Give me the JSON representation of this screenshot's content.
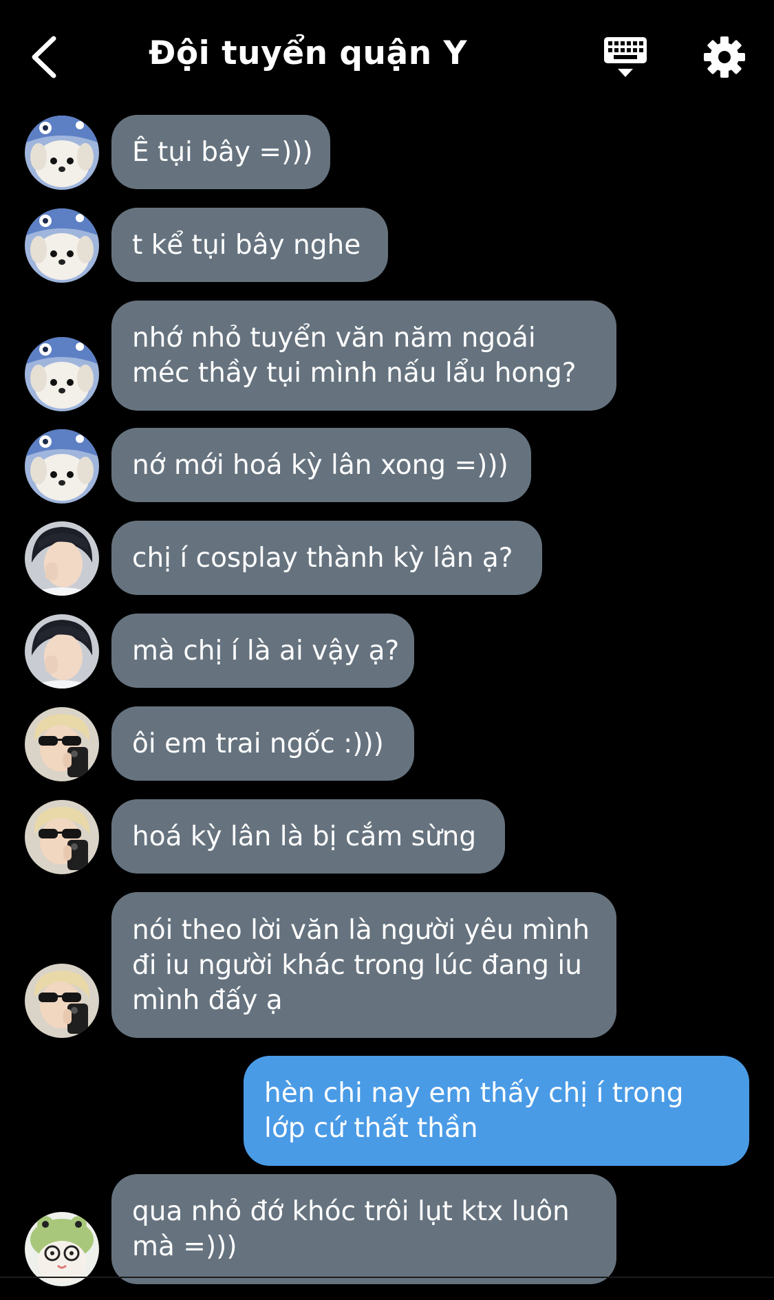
{
  "header": {
    "title": "Đội tuyển quận Y",
    "back_icon": "chevron-left-icon",
    "keyboard_icon": "keyboard-icon",
    "settings_icon": "gear-icon"
  },
  "colors": {
    "background": "#000000",
    "incoming_bubble": "#66737f",
    "outgoing_bubble": "#4a9be6",
    "text": "#ffffff"
  },
  "messages": [
    {
      "sender": "dog-avatar",
      "direction": "incoming",
      "text": "Ê tụi bây =)))"
    },
    {
      "sender": "dog-avatar",
      "direction": "incoming",
      "text": "t kể tụi bây nghe"
    },
    {
      "sender": "dog-avatar",
      "direction": "incoming",
      "text": "nhớ nhỏ tuyển văn năm ngoái\nméc thầy tụi mình nấu lẩu hong?"
    },
    {
      "sender": "dog-avatar",
      "direction": "incoming",
      "text": "nớ mới hoá kỳ lân xong =)))"
    },
    {
      "sender": "boy-avatar",
      "direction": "incoming",
      "text": "chị í cosplay thành kỳ lân ạ?"
    },
    {
      "sender": "boy-avatar",
      "direction": "incoming",
      "text": "mà chị í là ai vậy ạ?"
    },
    {
      "sender": "sunglasses-avatar",
      "direction": "incoming",
      "text": "ôi em trai ngốc :)))"
    },
    {
      "sender": "sunglasses-avatar",
      "direction": "incoming",
      "text": "hoá kỳ lân là bị cắm sừng"
    },
    {
      "sender": "sunglasses-avatar",
      "direction": "incoming",
      "text": "nói theo lời văn là người yêu mình\nđi iu người khác trong lúc đang iu\nmình đấy ạ"
    },
    {
      "sender": "me",
      "direction": "outgoing",
      "text": "hèn chi nay em thấy chị í trong\nlớp cứ thất thần"
    },
    {
      "sender": "frog-avatar",
      "direction": "incoming",
      "text": "qua nhỏ đớ khóc trôi lụt ktx luôn\nmà =)))"
    }
  ]
}
